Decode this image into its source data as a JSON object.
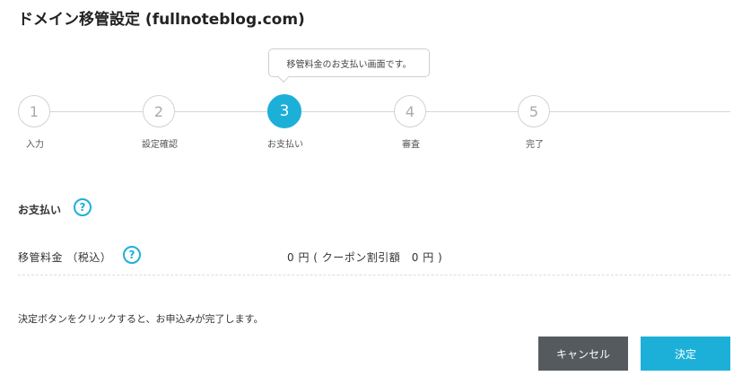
{
  "header": {
    "title": "ドメイン移管設定 (fullnoteblog.com)"
  },
  "stepper": {
    "tooltip": "移管料金のお支払い画面です。",
    "steps": [
      {
        "number": "1",
        "label": "入力"
      },
      {
        "number": "2",
        "label": "設定確認"
      },
      {
        "number": "3",
        "label": "お支払い"
      },
      {
        "number": "4",
        "label": "審査"
      },
      {
        "number": "5",
        "label": "完了"
      }
    ],
    "active_step": 3
  },
  "payment": {
    "section_title": "お支払い",
    "help_icon": "?",
    "fee_label": "移管料金 （税込）",
    "fee_value": "0 円 ( クーポン割引額　0 円 )"
  },
  "notice": "決定ボタンをクリックすると、お申込みが完了します。",
  "buttons": {
    "cancel": "キャンセル",
    "submit": "決定"
  },
  "colors": {
    "accent": "#1cb0d8",
    "cancel_button": "#555a5e"
  }
}
